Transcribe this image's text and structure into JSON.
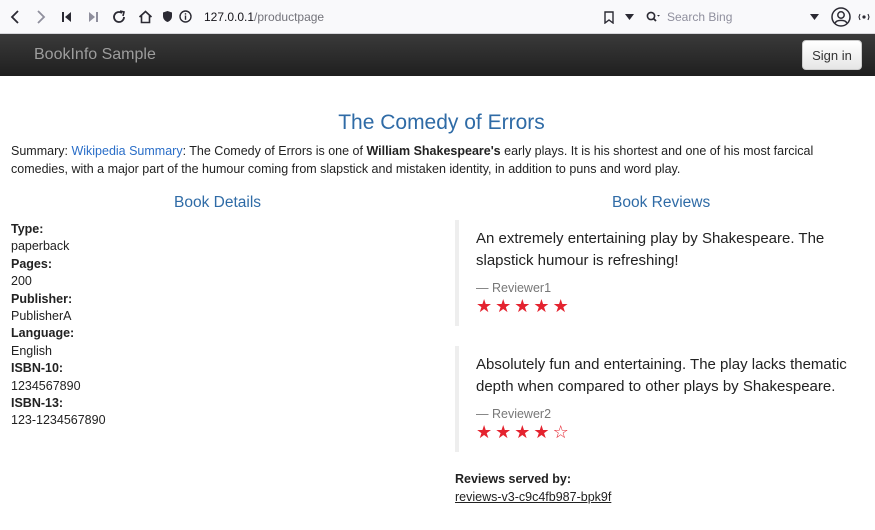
{
  "browser": {
    "url_host": "127.0.0.1",
    "url_path": "/productpage",
    "search_placeholder": "Search Bing"
  },
  "navbar": {
    "brand": "BookInfo Sample",
    "signin_label": "Sign in"
  },
  "product": {
    "title": "The Comedy of Errors",
    "summary_label": "Summary: ",
    "summary_link": "Wikipedia Summary",
    "summary_text_1": ": The Comedy of Errors is one of ",
    "summary_bold": "William Shakespeare's",
    "summary_text_2": " early plays. It is his shortest and one of his most farcical comedies, with a major part of the humour coming from slapstick and mistaken identity, in addition to puns and word play."
  },
  "details": {
    "heading": "Book Details",
    "items": [
      {
        "label": "Type:",
        "value": "paperback"
      },
      {
        "label": "Pages:",
        "value": "200"
      },
      {
        "label": "Publisher:",
        "value": "PublisherA"
      },
      {
        "label": "Language:",
        "value": "English"
      },
      {
        "label": "ISBN-10:",
        "value": "1234567890"
      },
      {
        "label": "ISBN-13:",
        "value": "123-1234567890"
      }
    ]
  },
  "reviews": {
    "heading": "Book Reviews",
    "items": [
      {
        "text": "An extremely entertaining play by Shakespeare. The slapstick humour is refreshing!",
        "reviewer": "— Reviewer1",
        "rating": 5
      },
      {
        "text": "Absolutely fun and entertaining. The play lacks thematic depth when compared to other plays by Shakespeare.",
        "reviewer": "— Reviewer2",
        "rating": 4
      }
    ],
    "star_color": "#e4232f",
    "served_label": "Reviews served by:",
    "served_value": "reviews-v3-c9c4fb987-bpk9f"
  }
}
